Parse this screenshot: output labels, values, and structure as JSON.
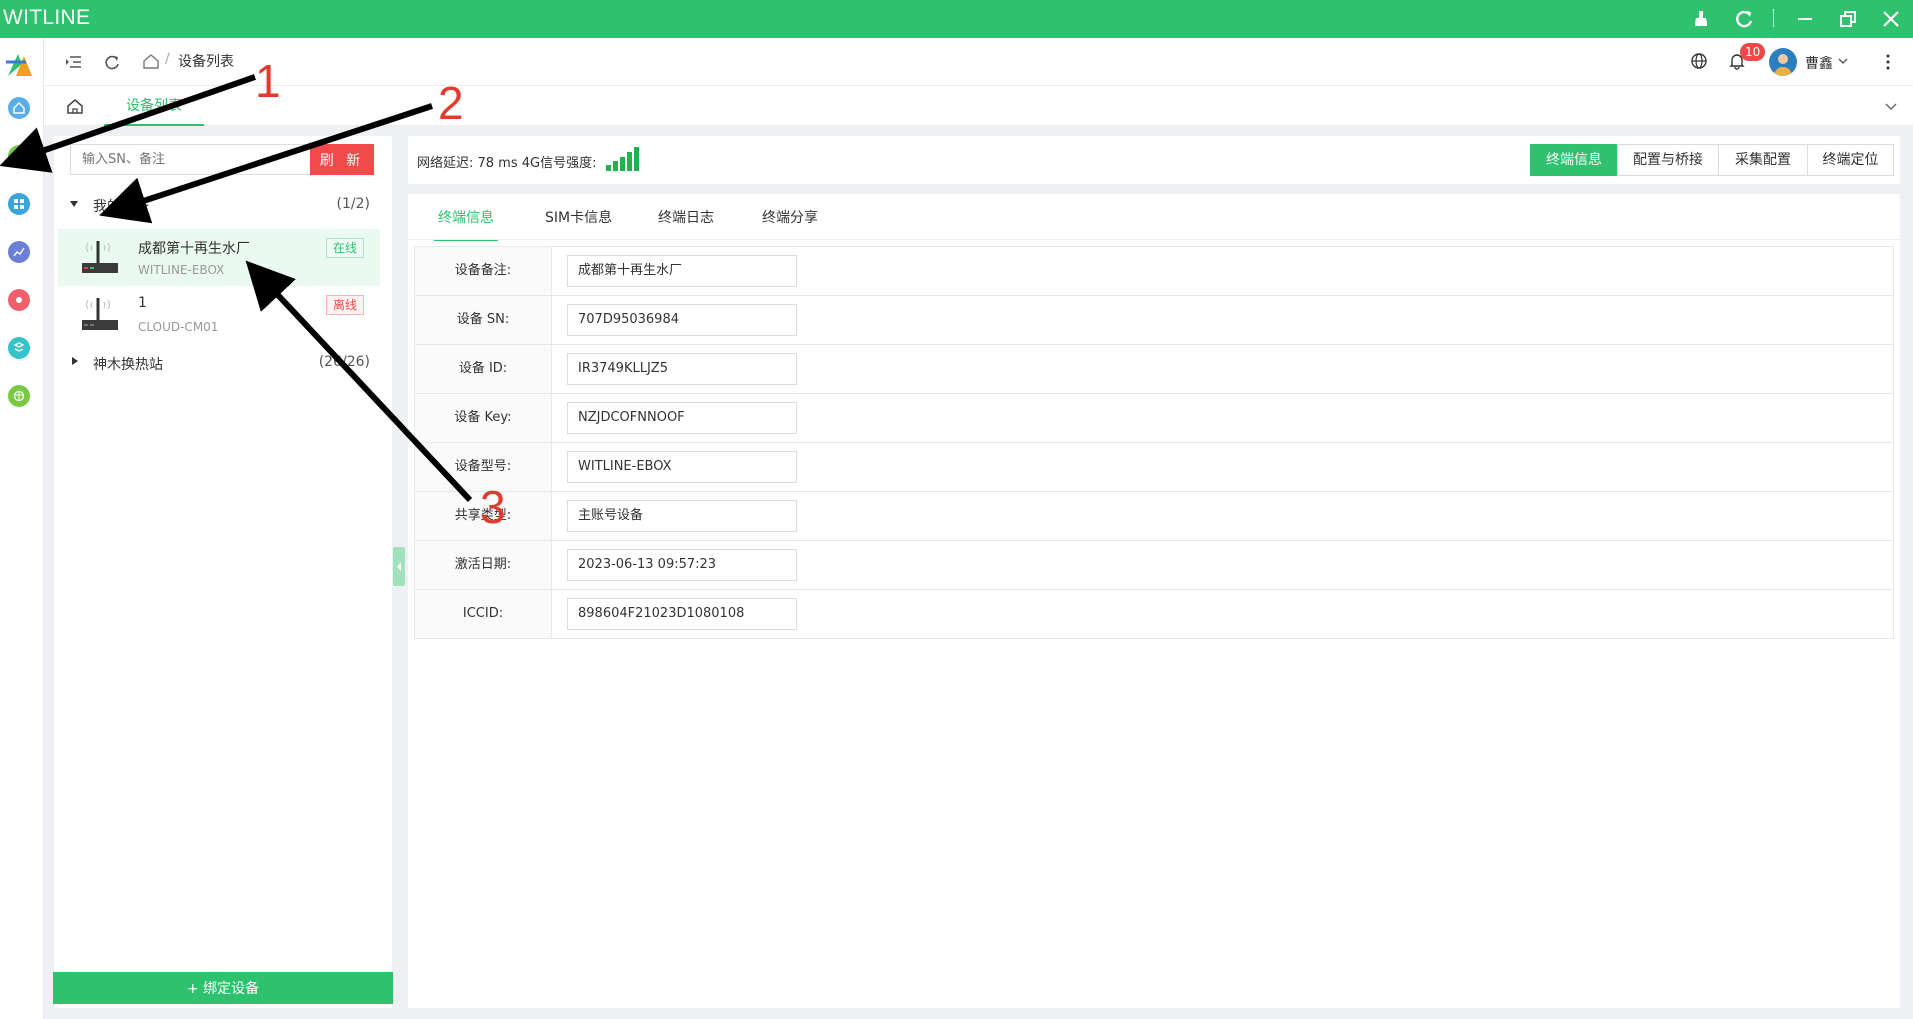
{
  "app": {
    "title": "WITLINE"
  },
  "nav": {
    "breadcrumb_sep": "/",
    "breadcrumb_current": "设备列表",
    "notification_count": "10",
    "user_name": "曹鑫"
  },
  "tabs": {
    "device_list": "设备列表"
  },
  "left": {
    "search_placeholder": "输入SN、备注",
    "refresh_label": "刷 新",
    "groups": [
      {
        "name": "我的设备",
        "count": "(1/2)",
        "devices": [
          {
            "name": "成都第十再生水厂",
            "model": "WITLINE-EBOX",
            "status": "在线"
          },
          {
            "name": "1",
            "model": "CLOUD-CM01",
            "status": "离线"
          }
        ]
      },
      {
        "name": "神木换热站",
        "count": "(26/26)"
      }
    ],
    "bind_label": "+ 绑定设备"
  },
  "topbar": {
    "latency_text": "网络延迟: 78 ms 4G信号强度:",
    "signal_bars": 5,
    "buttons": [
      "终端信息",
      "配置与桥接",
      "采集配置",
      "终端定位"
    ]
  },
  "detail": {
    "subtabs": [
      "终端信息",
      "SIM卡信息",
      "终端日志",
      "终端分享"
    ],
    "rows": [
      {
        "label": "设备备注:",
        "value": "成都第十再生水厂"
      },
      {
        "label": "设备 SN:",
        "value": "707D95036984"
      },
      {
        "label": "设备 ID:",
        "value": "IR3749KLLJZ5"
      },
      {
        "label": "设备 Key:",
        "value": "NZJDCOFNNOOF"
      },
      {
        "label": "设备型号:",
        "value": "WITLINE-EBOX"
      },
      {
        "label": "共享类型:",
        "value": "主账号设备"
      },
      {
        "label": "激活日期:",
        "value": "2023-06-13 09:57:23"
      },
      {
        "label": "ICCID:",
        "value": "898604F21023D1080108"
      }
    ]
  },
  "annotations": {
    "labels": [
      "1",
      "2",
      "3"
    ]
  },
  "colors": {
    "brand": "#2ec26e",
    "danger": "#f24a4a",
    "offline": "#f04848"
  }
}
